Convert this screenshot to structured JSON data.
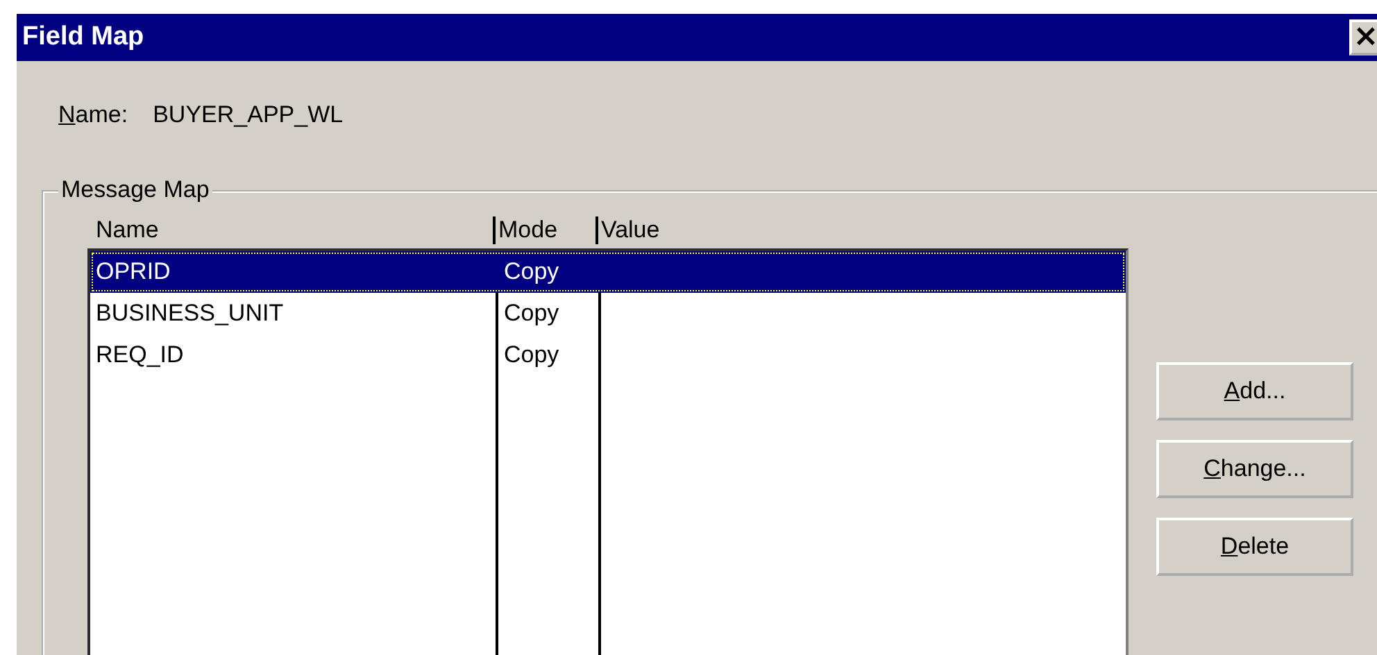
{
  "window": {
    "title": "Field Map",
    "close": "×"
  },
  "name_field": {
    "label": "Name:",
    "value": "BUYER_APP_WL"
  },
  "group": {
    "title": "Message Map"
  },
  "table": {
    "columns": [
      "Name",
      "Mode",
      "Value"
    ],
    "rows": [
      {
        "name": "OPRID",
        "mode": "Copy",
        "value": "",
        "selected": true
      },
      {
        "name": "BUSINESS_UNIT",
        "mode": "Copy",
        "value": "",
        "selected": false
      },
      {
        "name": "REQ_ID",
        "mode": "Copy",
        "value": "",
        "selected": false
      }
    ]
  },
  "buttons": [
    "Add...",
    "Change...",
    "Delete"
  ]
}
